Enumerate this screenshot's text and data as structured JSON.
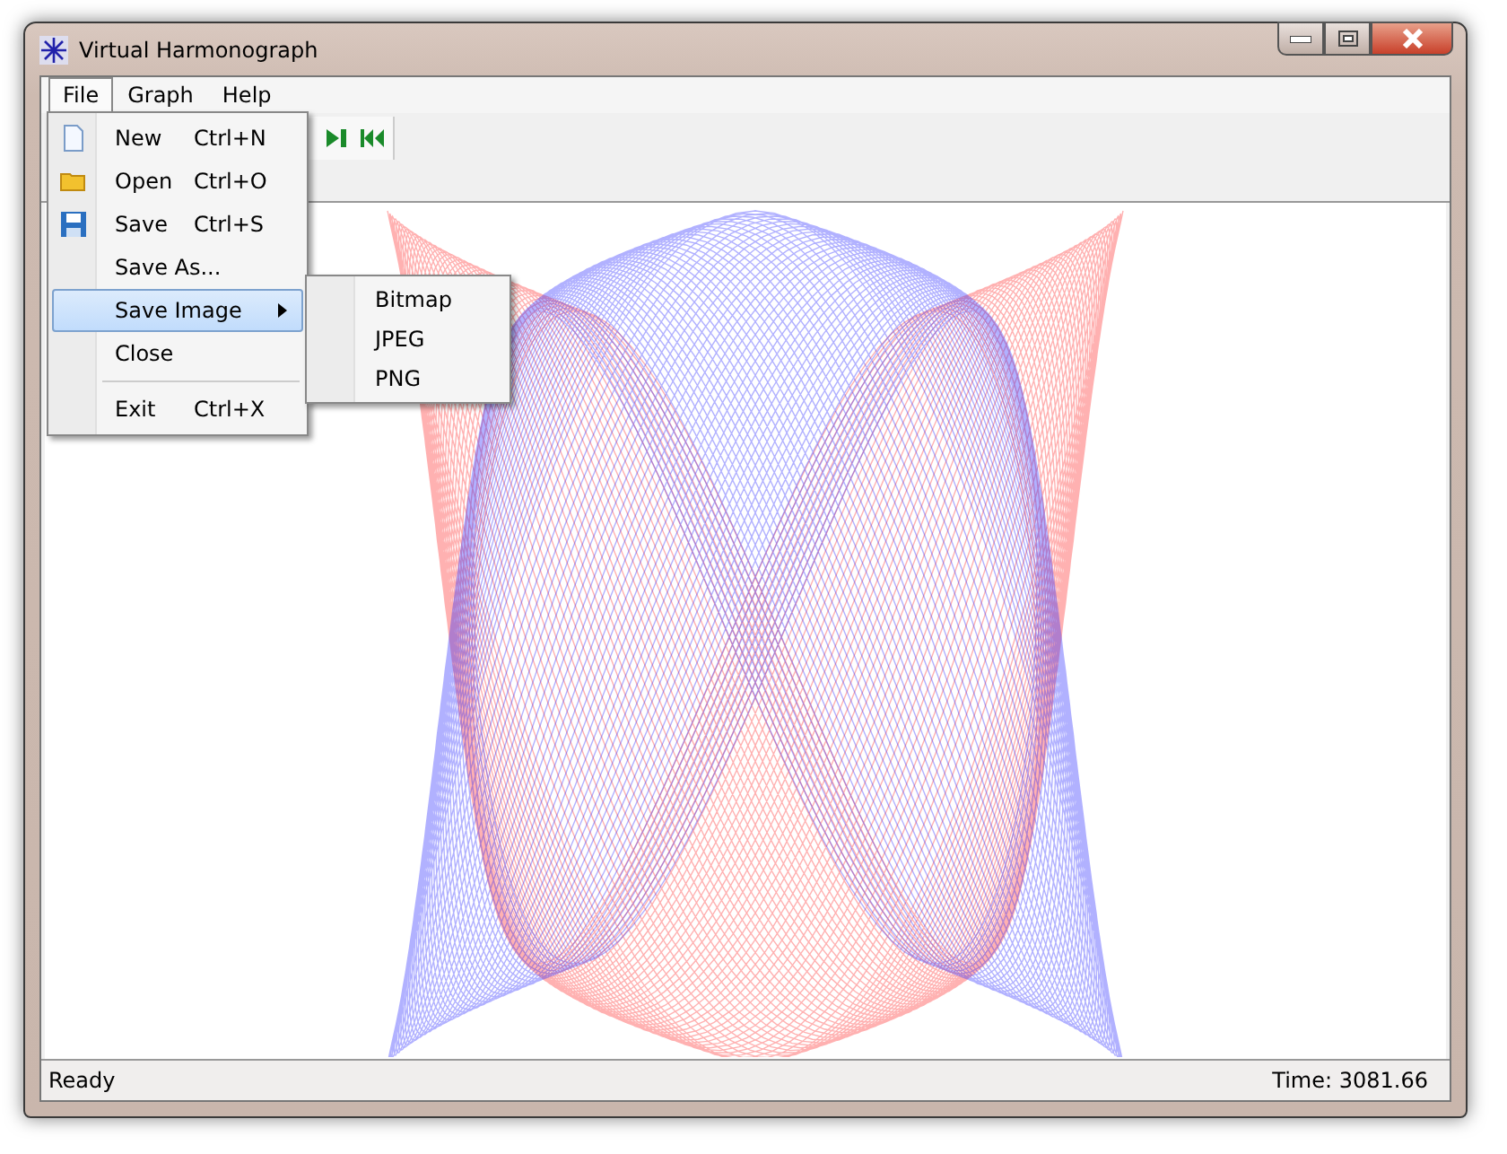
{
  "window": {
    "title": "Virtual Harmonograph"
  },
  "menu_bar": [
    {
      "label": "File",
      "selected": true
    },
    {
      "label": "Graph",
      "selected": false
    },
    {
      "label": "Help",
      "selected": false
    }
  ],
  "file_menu": [
    {
      "kind": "item",
      "label": "New",
      "shortcut": "Ctrl+N",
      "selected": false
    },
    {
      "kind": "item",
      "label": "Open",
      "shortcut": "Ctrl+O",
      "selected": false
    },
    {
      "kind": "item",
      "label": "Save",
      "shortcut": "Ctrl+S",
      "selected": false
    },
    {
      "kind": "item",
      "label": "Save As...",
      "selected": false
    },
    {
      "kind": "submenu",
      "label": "Save Image",
      "selected": true
    },
    {
      "kind": "item",
      "label": "Close",
      "selected": false
    },
    {
      "kind": "separator"
    },
    {
      "kind": "item",
      "label": "Exit",
      "shortcut": "Ctrl+X",
      "selected": false
    }
  ],
  "save_image_submenu": [
    "Bitmap",
    "JPEG",
    "PNG"
  ],
  "status_bar": {
    "message": "Ready",
    "time": "Time: 3081.66"
  }
}
